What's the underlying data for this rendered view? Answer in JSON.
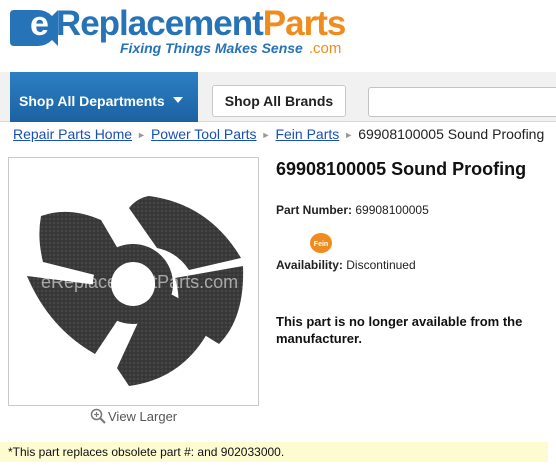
{
  "logo": {
    "word_e": "e",
    "word_replacement": "Replacement",
    "word_parts": "Parts",
    "tagline": "Fixing Things Makes Sense",
    "dotcom": ".com"
  },
  "nav": {
    "departments_label": "Shop All Departments",
    "brands_label": "Shop All Brands",
    "search_value": ""
  },
  "breadcrumb": {
    "items": [
      "Repair Parts Home",
      "Power Tool Parts",
      "Fein Parts"
    ],
    "current": "69908100005 Sound Proofing"
  },
  "product": {
    "title": "69908100005 Sound Proofing",
    "part_number_label": "Part Number:",
    "part_number": "69908100005",
    "brand_logo": "Fein",
    "availability_label": "Availability:",
    "availability": "Discontinued",
    "unavailable_message": "This part is no longer available from the manufacturer.",
    "image_watermark": "eReplacementParts.com",
    "view_larger": "View Larger"
  },
  "footnote": "*This part replaces obsolete part #: and 902033000.",
  "colors": {
    "brand_blue": "#2673b8",
    "brand_orange": "#f08c1e",
    "link": "#1a4fb3",
    "footnote_bg": "#fdfbd0"
  }
}
